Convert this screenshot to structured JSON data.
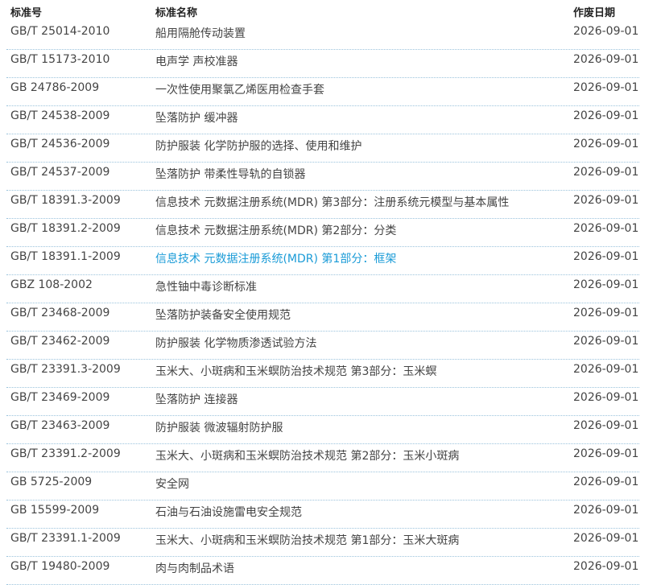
{
  "header": {
    "code": "标准号",
    "name": "标准名称",
    "date": "作废日期"
  },
  "rows": [
    {
      "code": "GB/T 25014-2010",
      "name": "船用隔舱传动装置",
      "date": "2026-09-01"
    },
    {
      "code": "GB/T 15173-2010",
      "name": "电声学 声校准器",
      "date": "2026-09-01"
    },
    {
      "code": "GB 24786-2009",
      "name": "一次性使用聚氯乙烯医用检查手套",
      "date": "2026-09-01"
    },
    {
      "code": "GB/T 24538-2009",
      "name": "坠落防护 缓冲器",
      "date": "2026-09-01"
    },
    {
      "code": "GB/T 24536-2009",
      "name": "防护服装 化学防护服的选择、使用和维护",
      "date": "2026-09-01"
    },
    {
      "code": "GB/T 24537-2009",
      "name": "坠落防护 带柔性导轨的自锁器",
      "date": "2026-09-01"
    },
    {
      "code": "GB/T 18391.3-2009",
      "name": "信息技术 元数据注册系统(MDR) 第3部分：注册系统元模型与基本属性",
      "date": "2026-09-01"
    },
    {
      "code": "GB/T 18391.2-2009",
      "name": "信息技术 元数据注册系统(MDR) 第2部分：分类",
      "date": "2026-09-01"
    },
    {
      "code": "GB/T 18391.1-2009",
      "name": "信息技术 元数据注册系统(MDR) 第1部分：框架",
      "date": "2026-09-01",
      "highlight": "#1a9bd7"
    },
    {
      "code": "GBZ 108-2002",
      "name": "急性铀中毒诊断标准",
      "date": "2026-09-01"
    },
    {
      "code": "GB/T 23468-2009",
      "name": "坠落防护装备安全使用规范",
      "date": "2026-09-01"
    },
    {
      "code": "GB/T 23462-2009",
      "name": "防护服装 化学物质渗透试验方法",
      "date": "2026-09-01"
    },
    {
      "code": "GB/T 23391.3-2009",
      "name": "玉米大、小斑病和玉米螟防治技术规范 第3部分：玉米螟",
      "date": "2026-09-01"
    },
    {
      "code": "GB/T 23469-2009",
      "name": "坠落防护 连接器",
      "date": "2026-09-01"
    },
    {
      "code": "GB/T 23463-2009",
      "name": "防护服装 微波辐射防护服",
      "date": "2026-09-01"
    },
    {
      "code": "GB/T 23391.2-2009",
      "name": "玉米大、小斑病和玉米螟防治技术规范 第2部分：玉米小斑病",
      "date": "2026-09-01"
    },
    {
      "code": "GB 5725-2009",
      "name": "安全网",
      "date": "2026-09-01"
    },
    {
      "code": "GB 15599-2009",
      "name": "石油与石油设施雷电安全规范",
      "date": "2026-09-01"
    },
    {
      "code": "GB/T 23391.1-2009",
      "name": "玉米大、小斑病和玉米螟防治技术规范 第1部分：玉米大斑病",
      "date": "2026-09-01"
    },
    {
      "code": "GB/T 19480-2009",
      "name": "肉与肉制品术语",
      "date": "2026-09-01"
    }
  ]
}
